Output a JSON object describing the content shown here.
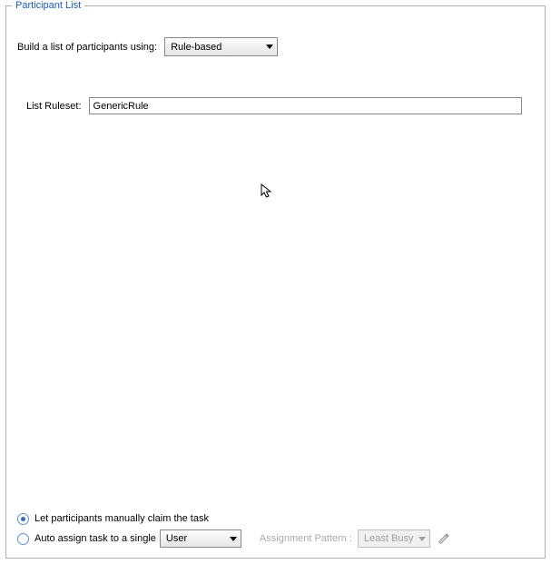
{
  "groupbox": {
    "title": "Participant List"
  },
  "build": {
    "label": "Build a list of participants using:",
    "selected": "Rule-based"
  },
  "ruleset": {
    "label": "List Ruleset:",
    "value": "GenericRule"
  },
  "options": {
    "manual": {
      "label": "Let participants manually claim the task",
      "checked": true
    },
    "auto": {
      "label": "Auto assign task to a single",
      "checked": false,
      "target": "User"
    },
    "pattern": {
      "label": "Assignment Pattern :",
      "selected": "Least Busy"
    }
  }
}
